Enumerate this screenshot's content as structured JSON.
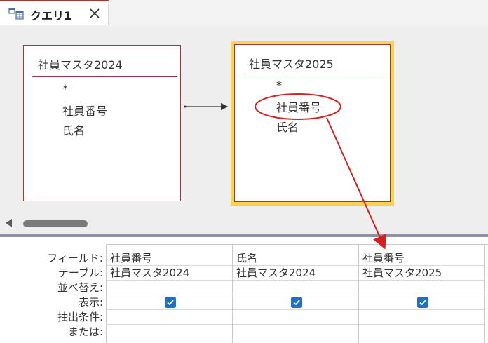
{
  "tab": {
    "title": "クエリ1",
    "icon": "query-icon",
    "close_icon": "close-icon"
  },
  "design": {
    "tables": [
      {
        "name": "社員マスタ2024",
        "fields": [
          "*",
          "社員番号",
          "氏名"
        ]
      },
      {
        "name": "社員マスタ2025",
        "fields": [
          "*",
          "社員番号",
          "氏名"
        ],
        "selected": true
      }
    ],
    "join": {
      "from": "社員マスタ2024",
      "to": "社員マスタ2025"
    }
  },
  "grid": {
    "row_labels": {
      "field": "フィールド:",
      "table": "テーブル:",
      "sort": "並べ替え:",
      "show": "表示:",
      "criteria": "抽出条件:",
      "or": "または:"
    },
    "columns": [
      {
        "field": "社員番号",
        "table": "社員マスタ2024",
        "sort": "",
        "show": true,
        "criteria": "",
        "or": ""
      },
      {
        "field": "氏名",
        "table": "社員マスタ2024",
        "sort": "",
        "show": true,
        "criteria": "",
        "or": ""
      },
      {
        "field": "社員番号",
        "table": "社員マスタ2025",
        "sort": "",
        "show": true,
        "criteria": "",
        "or": ""
      }
    ]
  },
  "colors": {
    "accent": "#a4373a",
    "selected_table_border": "#fcd34d",
    "annotation": "#d62020",
    "checkbox": "#1f6fc6",
    "splitter": "#8f8fa8"
  }
}
